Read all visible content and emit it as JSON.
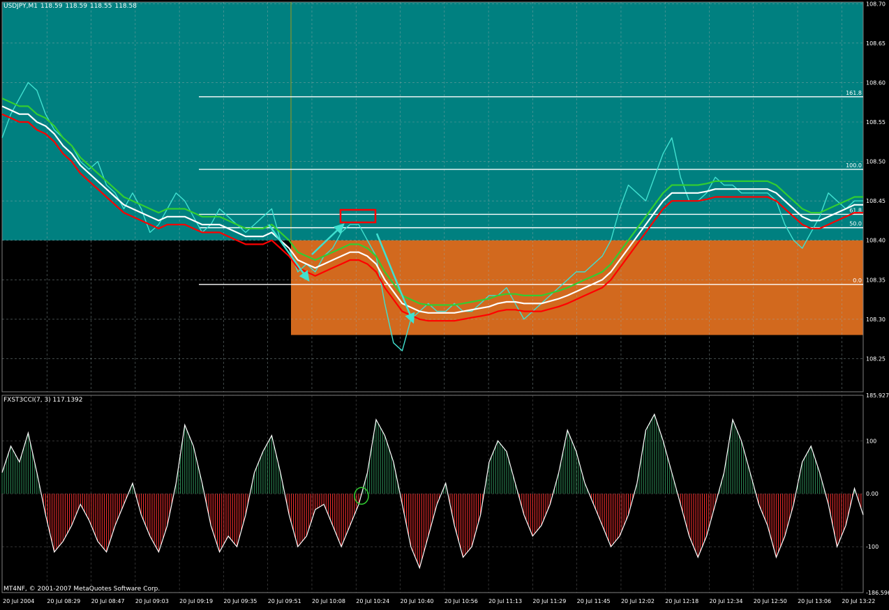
{
  "header": {
    "symbol": "USDJPY,M1",
    "open": "118.59",
    "high": "118.59",
    "low": "118.55",
    "close": "118.58"
  },
  "indicator_header": "FXST3CCI(7, 3) 117.1392",
  "copyright": "MT4NF, © 2001-2007 MetaQuotes Software Corp.",
  "colors": {
    "price_bg": "#008080",
    "orange_zone": "#D2691E",
    "price_line": "#40E0D0",
    "ma_green": "#32CD32",
    "ma_white": "#FFFFFF",
    "ma_red": "#FF0000",
    "fib": "#FFFFFF",
    "annotation_arrow": "#40E0D0",
    "annotation_box": "#FF0000",
    "annotation_circle": "#32CD32",
    "hist_pos": "#2E8B57",
    "hist_neg": "#FF3030"
  },
  "chart_data": [
    {
      "type": "line",
      "panel": "price",
      "title": "USDJPY,M1",
      "time_labels": [
        "20 Jul 2004",
        "20 Jul 08:29",
        "20 Jul 08:47",
        "20 Jul 09:03",
        "20 Jul 09:19",
        "20 Jul 09:35",
        "20 Jul 09:51",
        "20 Jul 10:08",
        "20 Jul 10:24",
        "20 Jul 10:40",
        "20 Jul 10:56",
        "20 Jul 11:13",
        "20 Jul 11:29",
        "20 Jul 11:45",
        "20 Jul 12:02",
        "20 Jul 12:18",
        "20 Jul 12:34",
        "20 Jul 12:50",
        "20 Jul 13:06",
        "20 Jul 13:22"
      ],
      "y_ticks": [
        "108.70",
        "108.65",
        "108.60",
        "108.55",
        "108.50",
        "108.45",
        "108.40",
        "108.35",
        "108.30",
        "108.25"
      ],
      "ylim": [
        108.208,
        108.702
      ],
      "teal_zone_bottom": 108.4,
      "orange_zone": {
        "from_index": 0.3355,
        "y_top": 108.4,
        "y_bottom": 108.28
      },
      "fib_levels": [
        {
          "label": "161.8",
          "value": 108.582
        },
        {
          "label": "100.0",
          "value": 108.49
        },
        {
          "label": "61.8",
          "value": 108.433
        },
        {
          "label": "50.0",
          "value": 108.416
        },
        {
          "label": "0.0",
          "value": 108.344
        }
      ],
      "series": [
        {
          "role": "close",
          "color": "#40E0D0",
          "values": [
            108.53,
            108.56,
            108.58,
            108.6,
            108.59,
            108.56,
            108.54,
            108.53,
            108.52,
            108.5,
            108.49,
            108.5,
            108.47,
            108.46,
            108.44,
            108.46,
            108.44,
            108.41,
            108.42,
            108.44,
            108.46,
            108.45,
            108.43,
            108.41,
            108.42,
            108.44,
            108.43,
            108.42,
            108.41,
            108.42,
            108.43,
            108.44,
            108.4,
            108.39,
            108.36,
            108.37,
            108.36,
            108.38,
            108.39,
            108.41,
            108.42,
            108.42,
            108.4,
            108.38,
            108.32,
            108.27,
            108.26,
            108.3,
            108.31,
            108.32,
            108.31,
            108.31,
            108.32,
            108.31,
            108.31,
            108.32,
            108.33,
            108.33,
            108.34,
            108.32,
            108.3,
            108.31,
            108.32,
            108.33,
            108.34,
            108.35,
            108.36,
            108.36,
            108.37,
            108.38,
            108.4,
            108.44,
            108.47,
            108.46,
            108.45,
            108.48,
            108.51,
            108.53,
            108.48,
            108.45,
            108.45,
            108.46,
            108.48,
            108.47,
            108.47,
            108.46,
            108.46,
            108.46,
            108.46,
            108.45,
            108.42,
            108.4,
            108.39,
            108.41,
            108.43,
            108.46,
            108.45,
            108.44,
            108.45,
            108.45
          ]
        },
        {
          "role": "ma_upper",
          "color": "#32CD32",
          "values": [
            108.58,
            108.575,
            108.57,
            108.57,
            108.56,
            108.555,
            108.545,
            108.53,
            108.52,
            108.505,
            108.495,
            108.485,
            108.475,
            108.465,
            108.455,
            108.45,
            108.445,
            108.44,
            108.435,
            108.44,
            108.44,
            108.44,
            108.435,
            108.43,
            108.43,
            108.43,
            108.425,
            108.42,
            108.415,
            108.415,
            108.415,
            108.42,
            108.41,
            108.4,
            108.385,
            108.38,
            108.375,
            108.38,
            108.385,
            108.39,
            108.395,
            108.395,
            108.39,
            108.38,
            108.36,
            108.345,
            108.33,
            108.325,
            108.32,
            108.318,
            108.318,
            108.318,
            108.318,
            108.32,
            108.322,
            108.324,
            108.326,
            108.33,
            108.332,
            108.332,
            108.33,
            108.33,
            108.33,
            108.333,
            108.336,
            108.34,
            108.345,
            108.35,
            108.355,
            108.36,
            108.37,
            108.385,
            108.4,
            108.415,
            108.43,
            108.445,
            108.46,
            108.47,
            108.47,
            108.47,
            108.47,
            108.472,
            108.475,
            108.475,
            108.475,
            108.475,
            108.475,
            108.475,
            108.475,
            108.47,
            108.46,
            108.45,
            108.44,
            108.435,
            108.435,
            108.44,
            108.445,
            108.45,
            108.455,
            108.455
          ]
        },
        {
          "role": "ma_mid",
          "color": "#FFFFFF",
          "values": [
            108.57,
            108.565,
            108.56,
            108.56,
            108.55,
            108.545,
            108.535,
            108.52,
            108.51,
            108.495,
            108.485,
            108.475,
            108.465,
            108.455,
            108.445,
            108.44,
            108.435,
            108.43,
            108.425,
            108.43,
            108.43,
            108.43,
            108.425,
            108.42,
            108.42,
            108.42,
            108.415,
            108.41,
            108.405,
            108.405,
            108.405,
            108.41,
            108.4,
            108.39,
            108.375,
            108.37,
            108.365,
            108.37,
            108.375,
            108.38,
            108.385,
            108.385,
            108.38,
            108.37,
            108.35,
            108.335,
            108.32,
            108.315,
            108.31,
            108.308,
            108.308,
            108.308,
            108.308,
            108.31,
            108.312,
            108.314,
            108.316,
            108.32,
            108.322,
            108.322,
            108.32,
            108.32,
            108.32,
            108.323,
            108.326,
            108.33,
            108.335,
            108.34,
            108.345,
            108.35,
            108.36,
            108.375,
            108.39,
            108.405,
            108.42,
            108.435,
            108.45,
            108.46,
            108.46,
            108.46,
            108.46,
            108.462,
            108.465,
            108.465,
            108.465,
            108.465,
            108.465,
            108.465,
            108.465,
            108.46,
            108.45,
            108.44,
            108.43,
            108.425,
            108.425,
            108.43,
            108.435,
            108.44,
            108.445,
            108.445
          ]
        },
        {
          "role": "ma_lower",
          "color": "#FF0000",
          "values": [
            108.56,
            108.555,
            108.55,
            108.55,
            108.54,
            108.535,
            108.525,
            108.51,
            108.5,
            108.485,
            108.475,
            108.465,
            108.455,
            108.445,
            108.435,
            108.43,
            108.425,
            108.42,
            108.415,
            108.42,
            108.42,
            108.42,
            108.415,
            108.41,
            108.41,
            108.41,
            108.405,
            108.4,
            108.395,
            108.395,
            108.395,
            108.4,
            108.39,
            108.38,
            108.365,
            108.36,
            108.355,
            108.36,
            108.365,
            108.37,
            108.375,
            108.375,
            108.37,
            108.36,
            108.34,
            108.325,
            108.31,
            108.305,
            108.3,
            108.298,
            108.298,
            108.298,
            108.298,
            108.3,
            108.302,
            108.304,
            108.306,
            108.31,
            108.312,
            108.312,
            108.31,
            108.31,
            108.31,
            108.313,
            108.316,
            108.32,
            108.325,
            108.33,
            108.335,
            108.34,
            108.35,
            108.365,
            108.38,
            108.395,
            108.41,
            108.425,
            108.44,
            108.45,
            108.45,
            108.45,
            108.45,
            108.452,
            108.455,
            108.455,
            108.455,
            108.455,
            108.455,
            108.455,
            108.455,
            108.45,
            108.44,
            108.43,
            108.42,
            108.415,
            108.415,
            108.42,
            108.425,
            108.43,
            108.435,
            108.435
          ]
        }
      ]
    },
    {
      "type": "bar",
      "panel": "indicator",
      "title": "FXST3CCI(7, 3) 117.1392",
      "y_ticks": [
        "185.927",
        "100",
        "0.00",
        "-100",
        "-186.596"
      ],
      "ylim": [
        -186.596,
        185.927
      ],
      "values": [
        40,
        90,
        60,
        115,
        40,
        -40,
        -110,
        -90,
        -60,
        -20,
        -50,
        -90,
        -110,
        -60,
        -20,
        20,
        -40,
        -80,
        -110,
        -60,
        20,
        130,
        90,
        20,
        -60,
        -110,
        -80,
        -100,
        -40,
        40,
        80,
        110,
        40,
        -40,
        -100,
        -80,
        -30,
        -20,
        -60,
        -100,
        -60,
        -20,
        40,
        140,
        110,
        60,
        -20,
        -100,
        -140,
        -80,
        -20,
        20,
        -60,
        -120,
        -100,
        -40,
        60,
        100,
        80,
        20,
        -40,
        -80,
        -60,
        -20,
        40,
        120,
        80,
        20,
        -20,
        -60,
        -100,
        -80,
        -40,
        20,
        120,
        150,
        100,
        40,
        -20,
        -80,
        -120,
        -80,
        -20,
        40,
        140,
        100,
        40,
        -20,
        -60,
        -120,
        -80,
        -20,
        60,
        90,
        40,
        -20,
        -100,
        -60,
        10,
        -40
      ]
    }
  ]
}
